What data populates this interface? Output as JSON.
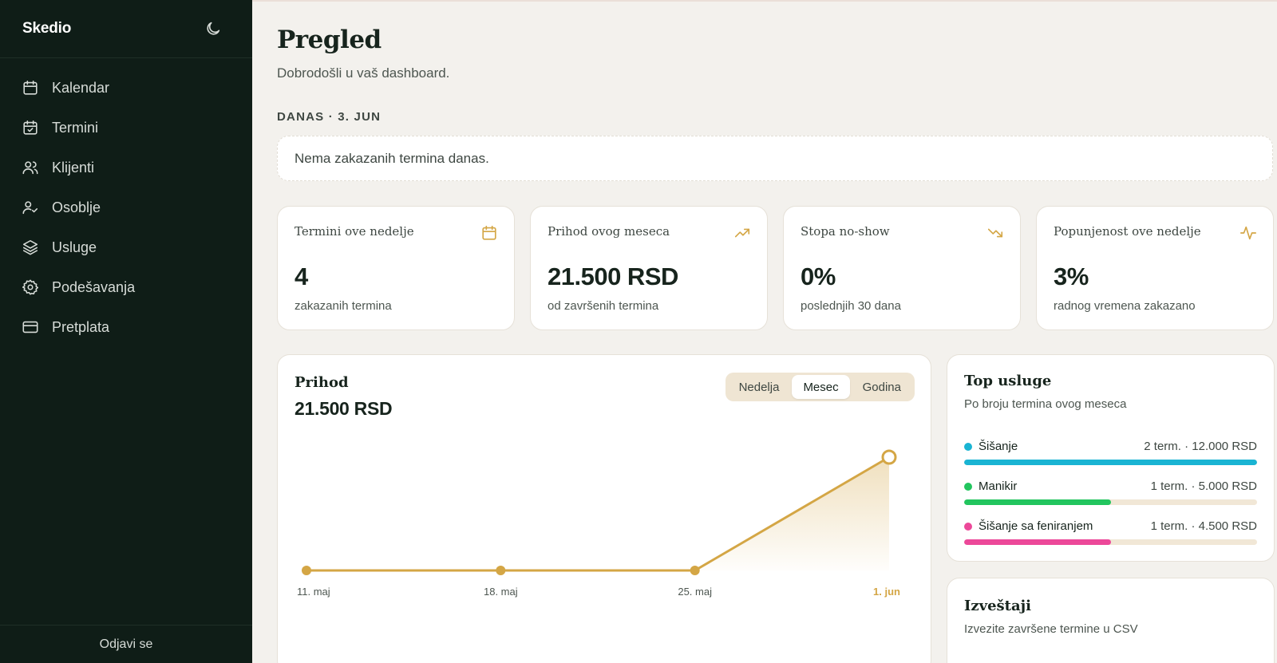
{
  "app": {
    "brand": "Skedio",
    "logout": "Odjavi se"
  },
  "sidebar": {
    "items": [
      {
        "label": "Kalendar",
        "icon": "calendar-icon"
      },
      {
        "label": "Termini",
        "icon": "calendar-check-icon"
      },
      {
        "label": "Klijenti",
        "icon": "users-icon"
      },
      {
        "label": "Osoblje",
        "icon": "user-check-icon"
      },
      {
        "label": "Usluge",
        "icon": "layers-icon"
      },
      {
        "label": "Podešavanja",
        "icon": "gear-icon"
      },
      {
        "label": "Pretplata",
        "icon": "credit-card-icon"
      }
    ]
  },
  "header": {
    "title": "Pregled",
    "subtitle": "Dobrodošli u vaš dashboard."
  },
  "today": {
    "label": "DANAS · 3. JUN",
    "empty": "Nema zakazanih termina danas."
  },
  "stats": [
    {
      "label": "Termini ove nedelje",
      "value": "4",
      "caption": "zakazanih termina",
      "icon": "calendar-icon"
    },
    {
      "label": "Prihod ovog meseca",
      "value": "21.500 RSD",
      "caption": "od završenih termina",
      "icon": "trending-up-icon"
    },
    {
      "label": "Stopa no-show",
      "value": "0%",
      "caption": "poslednjih 30 dana",
      "icon": "trending-down-icon"
    },
    {
      "label": "Popunjenost ove nedelje",
      "value": "3%",
      "caption": "radnog vremena zakazano",
      "icon": "activity-icon"
    }
  ],
  "revenue": {
    "title": "Prihod",
    "total": "21.500 RSD",
    "periods": [
      "Nedelja",
      "Mesec",
      "Godina"
    ],
    "active_period": "Mesec"
  },
  "chart_data": {
    "type": "area",
    "categories": [
      "11. maj",
      "18. maj",
      "25. maj",
      "1. jun"
    ],
    "series": [
      {
        "values": [
          0,
          0,
          0,
          21500
        ]
      }
    ],
    "highlight_category": "1. jun",
    "color": "#d4a645",
    "grid": false
  },
  "top_services": {
    "title": "Top usluge",
    "subtitle": "Po broju termina ovog meseca",
    "items": [
      {
        "name": "Šišanje",
        "meta": "2 term. · 12.000 RSD",
        "color": "#1ab4d3",
        "fraction": 1.0
      },
      {
        "name": "Manikir",
        "meta": "1 term. · 5.000 RSD",
        "color": "#22c55e",
        "fraction": 0.5
      },
      {
        "name": "Šišanje sa feniranjem",
        "meta": "1 term. · 4.500 RSD",
        "color": "#ec4899",
        "fraction": 0.5
      }
    ]
  },
  "reports": {
    "title": "Izveštaji",
    "subtitle": "Izvezite završene termine u CSV"
  },
  "colors": {
    "sidebar": "#0f1d17",
    "accent": "#d4a645",
    "background": "#f3f1ed"
  }
}
